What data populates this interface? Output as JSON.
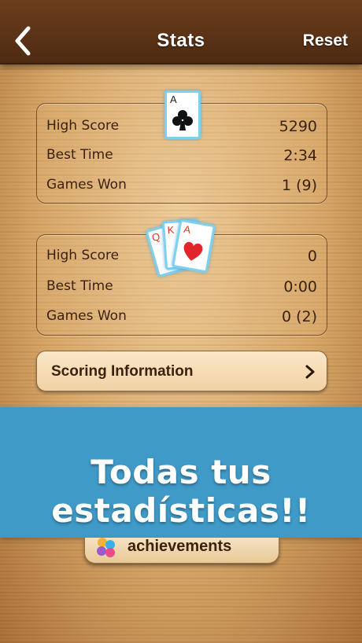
{
  "header": {
    "title": "Stats",
    "reset_label": "Reset"
  },
  "panel1": {
    "card": {
      "rank": "A",
      "suit": "clubs"
    },
    "rows": [
      {
        "label": "High Score",
        "value": "5290"
      },
      {
        "label": "Best Time",
        "value": "2:34"
      },
      {
        "label": "Games Won",
        "value": "1 (9)"
      }
    ]
  },
  "panel2": {
    "cards": [
      {
        "rank": "Q",
        "suit": "hearts"
      },
      {
        "rank": "K",
        "suit": "hearts"
      },
      {
        "rank": "A",
        "suit": "hearts"
      }
    ],
    "rows": [
      {
        "label": "High Score",
        "value": "0"
      },
      {
        "label": "Best Time",
        "value": "0:00"
      },
      {
        "label": "Games Won",
        "value": "0 (2)"
      }
    ]
  },
  "scoring": {
    "label": "Scoring Information"
  },
  "banner": {
    "text": "Todas tus estadísticas!!"
  },
  "achievements": {
    "label": "achievements"
  },
  "colors": {
    "banner": "#3f9ac8",
    "header": "#5a3216",
    "card_border": "#7fd0ee",
    "heart_red": "#e0262b"
  }
}
